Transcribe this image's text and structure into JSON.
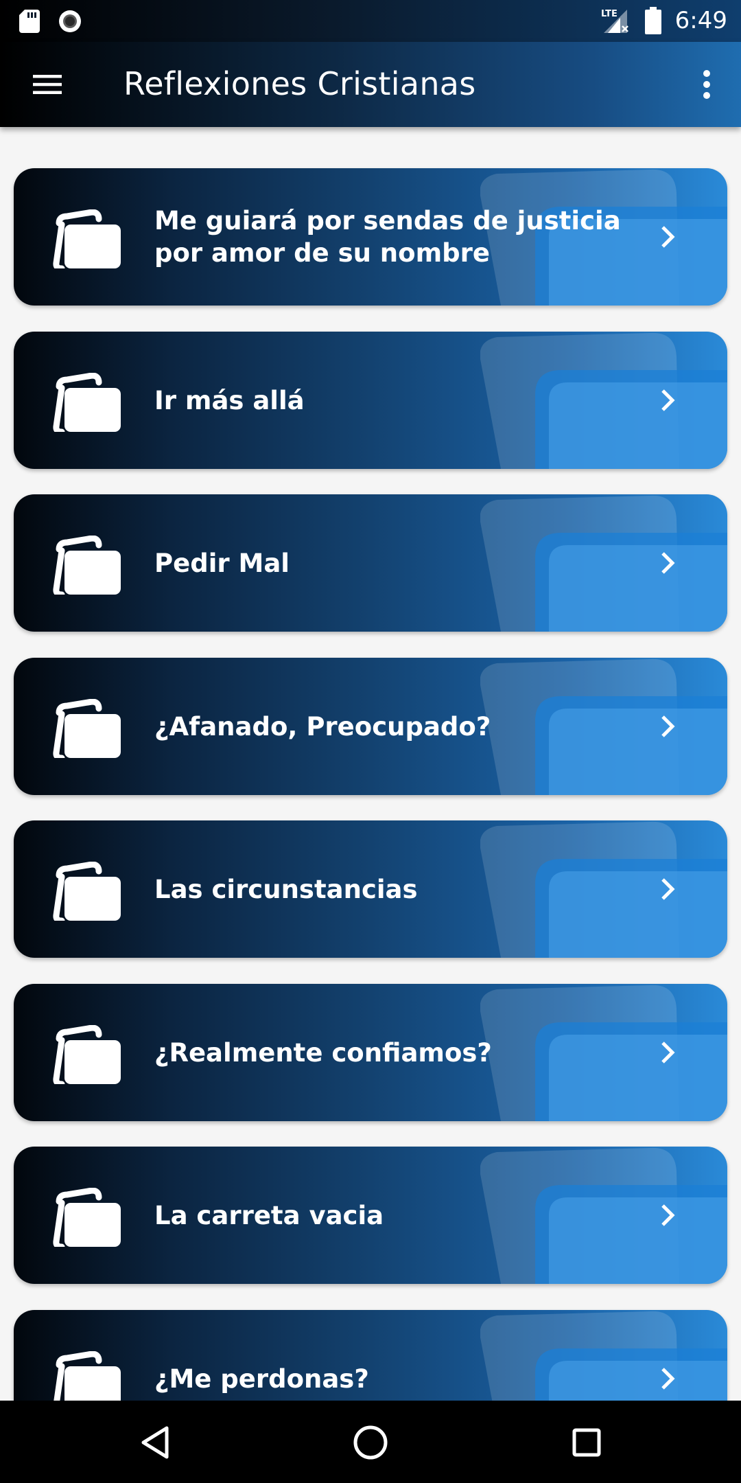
{
  "status_bar": {
    "time": "6:49",
    "network_label": "LTE",
    "icons": [
      "sd-card-icon",
      "record-icon",
      "signal-icon",
      "battery-icon"
    ]
  },
  "app_bar": {
    "title": "Reflexiones Cristianas",
    "menu_icon": "hamburger-menu-icon",
    "overflow_icon": "more-vert-icon"
  },
  "reflections": [
    {
      "title": "Me guiará por sendas de justicia por amor de su nombre"
    },
    {
      "title": "Ir más allá"
    },
    {
      "title": "Pedir Mal"
    },
    {
      "title": "¿Afanado, Preocupado?"
    },
    {
      "title": "Las circunstancias"
    },
    {
      "title": "¿Realmente confiamos?"
    },
    {
      "title": "La carreta vacia"
    },
    {
      "title": "¿Me perdonas?"
    }
  ],
  "colors": {
    "card_gradient_start": "#02070d",
    "card_gradient_end": "#2a8ad8",
    "background": "#f5f5f5",
    "nav_bar": "#000000"
  },
  "nav_bar": {
    "buttons": [
      "back-icon",
      "home-icon",
      "recents-icon"
    ]
  }
}
